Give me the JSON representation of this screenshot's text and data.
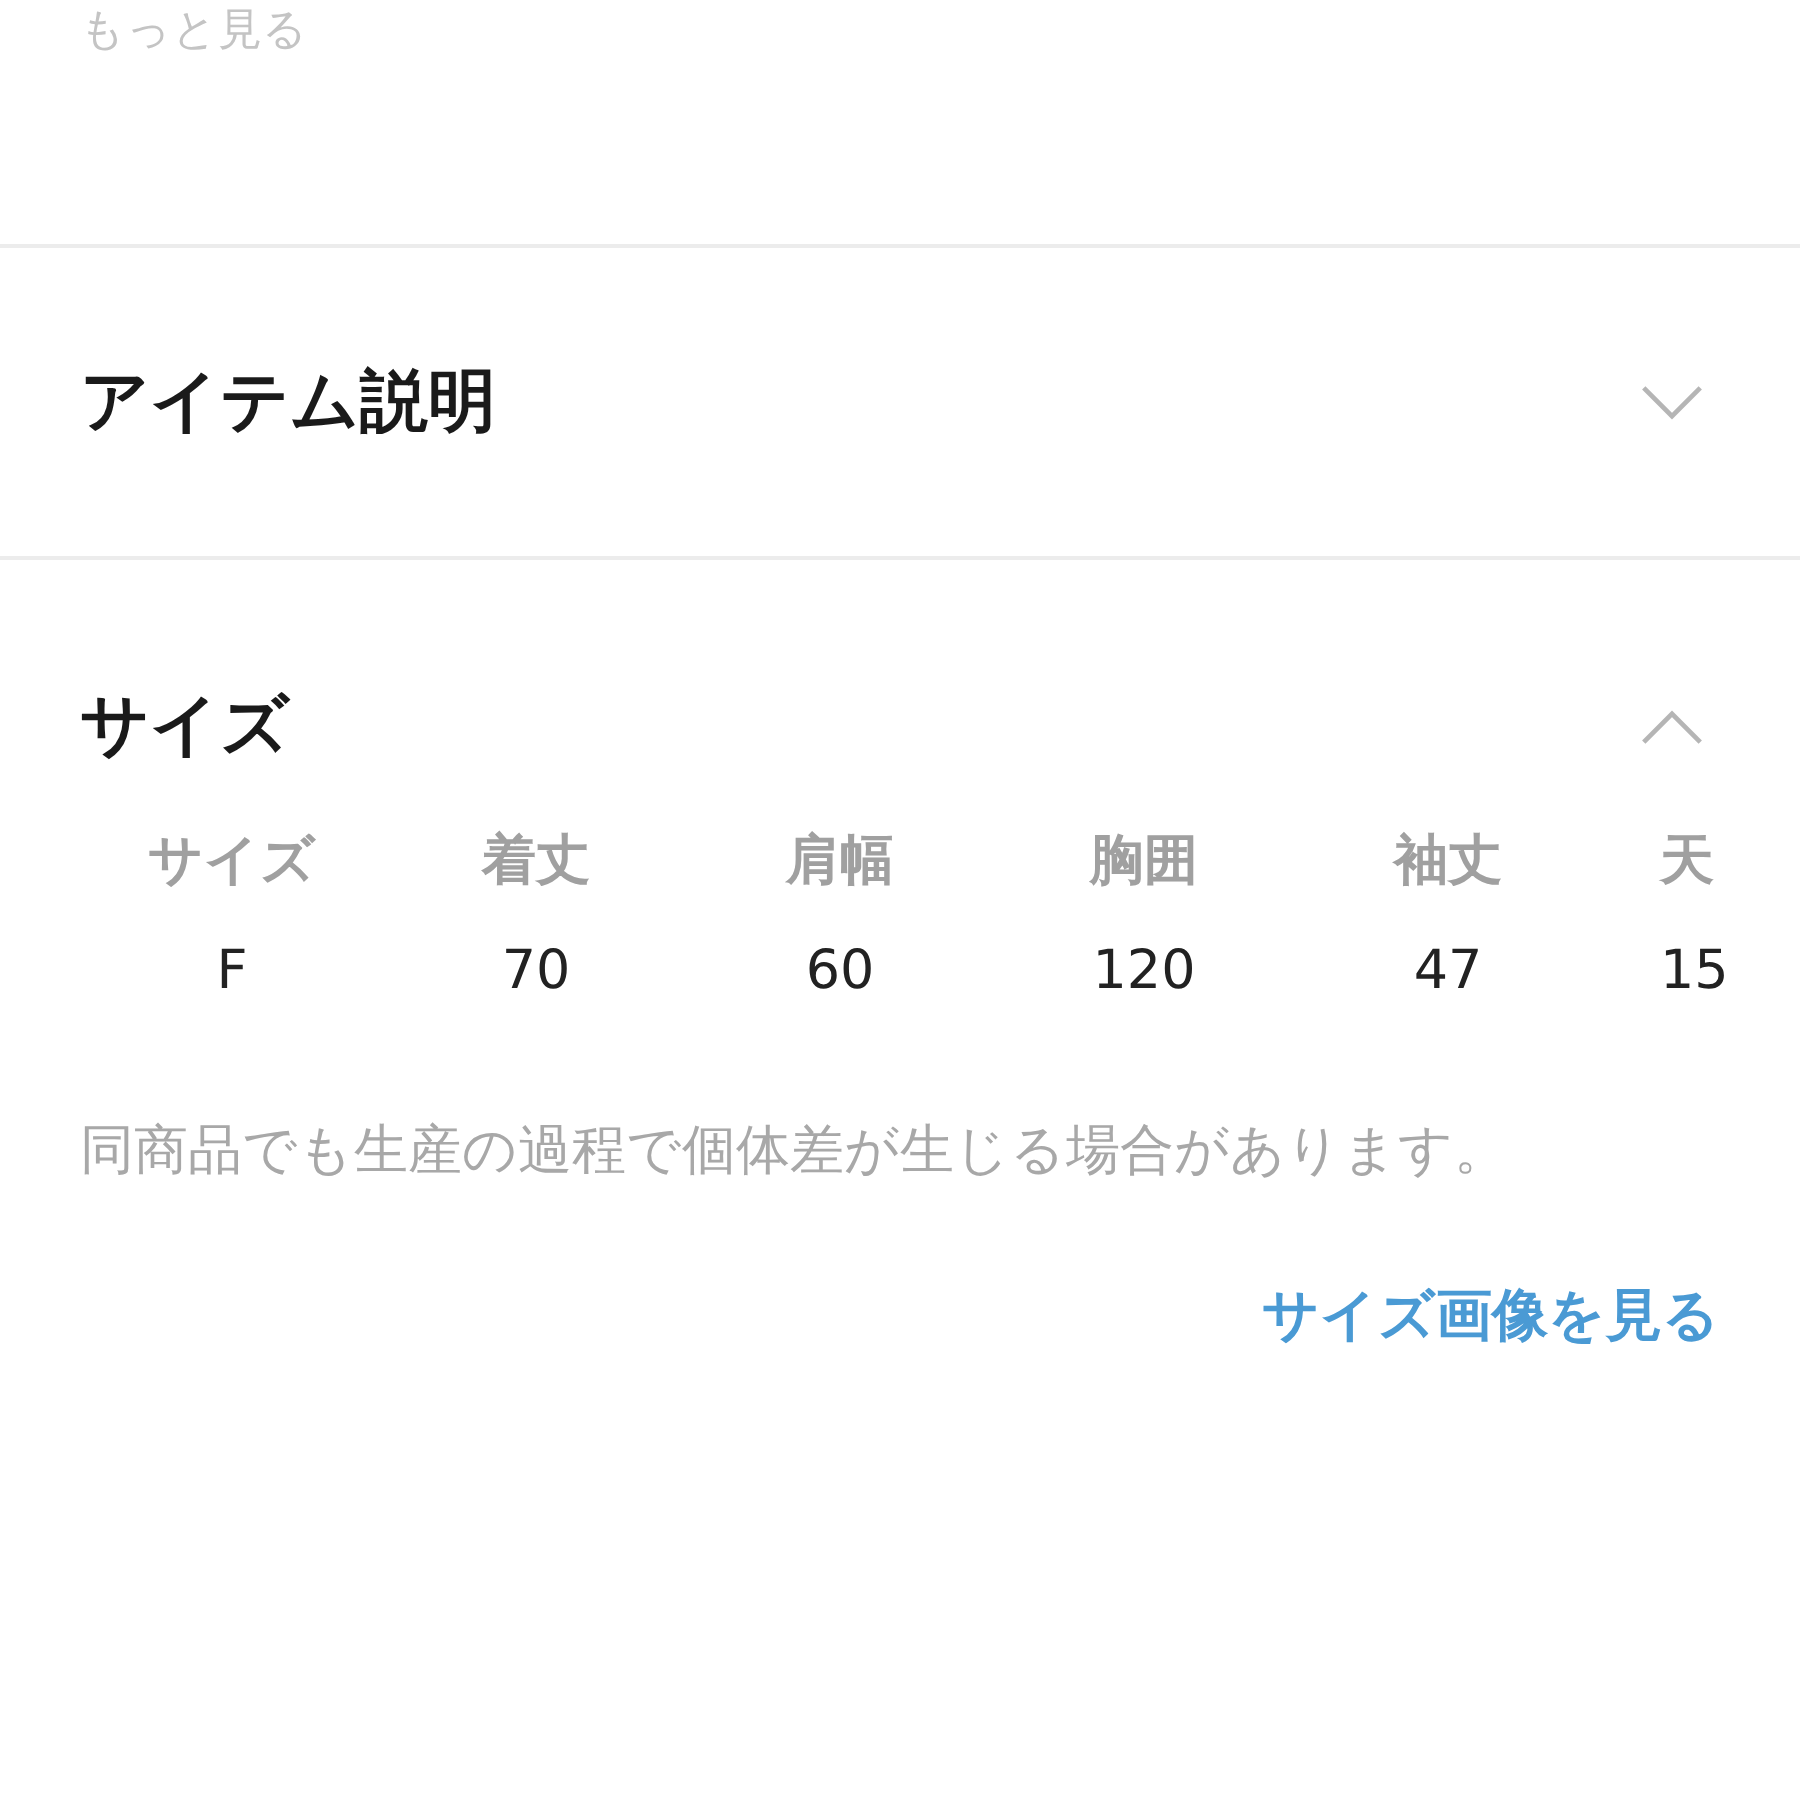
{
  "more_link": "もっと見る",
  "sections": [
    {
      "title": "アイテム説明",
      "expanded": false
    },
    {
      "title": "サイズ",
      "expanded": true,
      "table": {
        "columns": [
          "サイズ",
          "着丈",
          "肩幅",
          "胸囲",
          "袖丈",
          "天"
        ],
        "rows": [
          [
            "F",
            "70",
            "60",
            "120",
            "47",
            "15"
          ]
        ]
      },
      "note": "同商品でも生産の過程で個体差が生じる場合があります。",
      "link": "サイズ画像を見る"
    }
  ]
}
